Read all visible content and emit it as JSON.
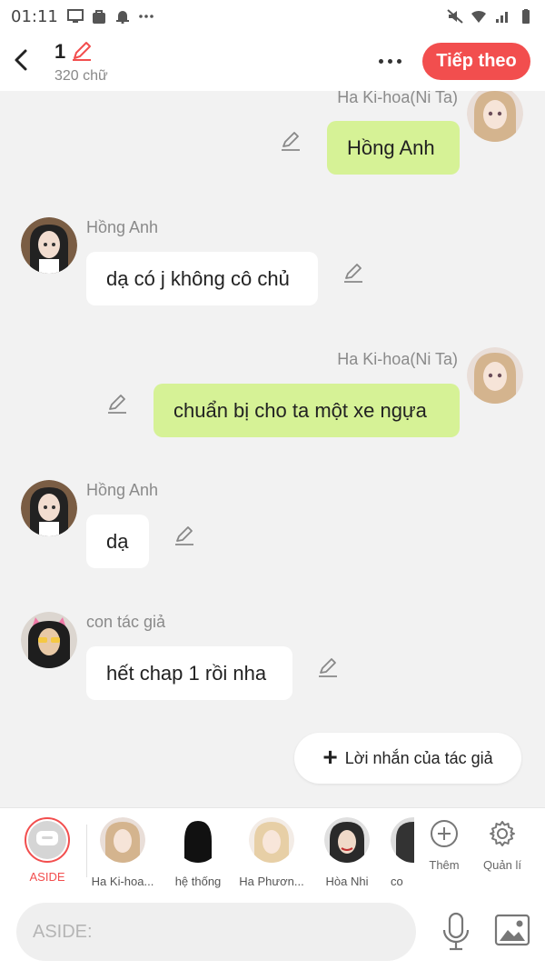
{
  "status_bar": {
    "time": "01:11"
  },
  "header": {
    "chapter_number": "1",
    "word_count": "320 chữ",
    "next_label": "Tiếp theo"
  },
  "messages": [
    {
      "side": "right",
      "sender": "Ha Ki-hoa(Ni Ta)",
      "text": "Hồng Anh"
    },
    {
      "side": "left",
      "sender": "Hồng Anh",
      "text": "dạ có j không cô chủ"
    },
    {
      "side": "right",
      "sender": "Ha Ki-hoa(Ni Ta)",
      "text": "chuẩn bị cho ta một xe ngựa"
    },
    {
      "side": "left",
      "sender": "Hồng Anh",
      "text": "dạ"
    },
    {
      "side": "left",
      "sender": "con tác giả",
      "text": "hết chap 1 rồi nha"
    }
  ],
  "author_note_label": "Lời nhắn của tác giả",
  "characters": [
    {
      "name": "ASIDE",
      "selected": true
    },
    {
      "name": "Ha Ki-hoa..."
    },
    {
      "name": "hệ thống"
    },
    {
      "name": "Ha Phươn..."
    },
    {
      "name": "Hòa Nhi"
    },
    {
      "name": "co"
    }
  ],
  "tools": {
    "add_label": "Thêm",
    "manage_label": "Quản lí"
  },
  "input": {
    "placeholder": "ASIDE:"
  },
  "colors": {
    "accent": "#f24e4e",
    "right_bubble": "#d6f296",
    "left_bubble": "#ffffff",
    "background": "#f2f2f2"
  }
}
